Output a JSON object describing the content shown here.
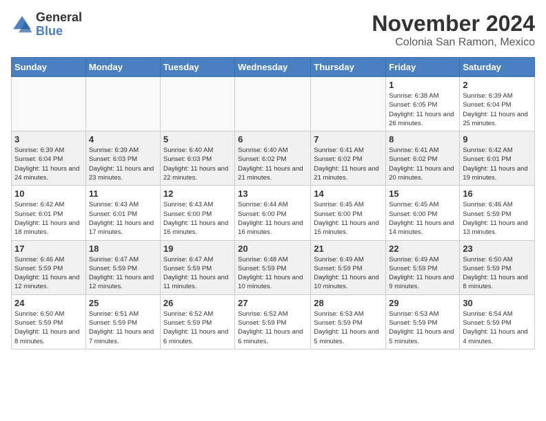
{
  "logo": {
    "general": "General",
    "blue": "Blue"
  },
  "title": "November 2024",
  "subtitle": "Colonia San Ramon, Mexico",
  "headers": [
    "Sunday",
    "Monday",
    "Tuesday",
    "Wednesday",
    "Thursday",
    "Friday",
    "Saturday"
  ],
  "weeks": [
    [
      {
        "day": "",
        "info": ""
      },
      {
        "day": "",
        "info": ""
      },
      {
        "day": "",
        "info": ""
      },
      {
        "day": "",
        "info": ""
      },
      {
        "day": "",
        "info": ""
      },
      {
        "day": "1",
        "info": "Sunrise: 6:38 AM\nSunset: 6:05 PM\nDaylight: 11 hours and 26 minutes."
      },
      {
        "day": "2",
        "info": "Sunrise: 6:39 AM\nSunset: 6:04 PM\nDaylight: 11 hours and 25 minutes."
      }
    ],
    [
      {
        "day": "3",
        "info": "Sunrise: 6:39 AM\nSunset: 6:04 PM\nDaylight: 11 hours and 24 minutes."
      },
      {
        "day": "4",
        "info": "Sunrise: 6:39 AM\nSunset: 6:03 PM\nDaylight: 11 hours and 23 minutes."
      },
      {
        "day": "5",
        "info": "Sunrise: 6:40 AM\nSunset: 6:03 PM\nDaylight: 11 hours and 22 minutes."
      },
      {
        "day": "6",
        "info": "Sunrise: 6:40 AM\nSunset: 6:02 PM\nDaylight: 11 hours and 21 minutes."
      },
      {
        "day": "7",
        "info": "Sunrise: 6:41 AM\nSunset: 6:02 PM\nDaylight: 11 hours and 21 minutes."
      },
      {
        "day": "8",
        "info": "Sunrise: 6:41 AM\nSunset: 6:02 PM\nDaylight: 11 hours and 20 minutes."
      },
      {
        "day": "9",
        "info": "Sunrise: 6:42 AM\nSunset: 6:01 PM\nDaylight: 11 hours and 19 minutes."
      }
    ],
    [
      {
        "day": "10",
        "info": "Sunrise: 6:42 AM\nSunset: 6:01 PM\nDaylight: 11 hours and 18 minutes."
      },
      {
        "day": "11",
        "info": "Sunrise: 6:43 AM\nSunset: 6:01 PM\nDaylight: 11 hours and 17 minutes."
      },
      {
        "day": "12",
        "info": "Sunrise: 6:43 AM\nSunset: 6:00 PM\nDaylight: 11 hours and 16 minutes."
      },
      {
        "day": "13",
        "info": "Sunrise: 6:44 AM\nSunset: 6:00 PM\nDaylight: 11 hours and 16 minutes."
      },
      {
        "day": "14",
        "info": "Sunrise: 6:45 AM\nSunset: 6:00 PM\nDaylight: 11 hours and 15 minutes."
      },
      {
        "day": "15",
        "info": "Sunrise: 6:45 AM\nSunset: 6:00 PM\nDaylight: 11 hours and 14 minutes."
      },
      {
        "day": "16",
        "info": "Sunrise: 6:46 AM\nSunset: 5:59 PM\nDaylight: 11 hours and 13 minutes."
      }
    ],
    [
      {
        "day": "17",
        "info": "Sunrise: 6:46 AM\nSunset: 5:59 PM\nDaylight: 11 hours and 12 minutes."
      },
      {
        "day": "18",
        "info": "Sunrise: 6:47 AM\nSunset: 5:59 PM\nDaylight: 11 hours and 12 minutes."
      },
      {
        "day": "19",
        "info": "Sunrise: 6:47 AM\nSunset: 5:59 PM\nDaylight: 11 hours and 11 minutes."
      },
      {
        "day": "20",
        "info": "Sunrise: 6:48 AM\nSunset: 5:59 PM\nDaylight: 11 hours and 10 minutes."
      },
      {
        "day": "21",
        "info": "Sunrise: 6:49 AM\nSunset: 5:59 PM\nDaylight: 11 hours and 10 minutes."
      },
      {
        "day": "22",
        "info": "Sunrise: 6:49 AM\nSunset: 5:59 PM\nDaylight: 11 hours and 9 minutes."
      },
      {
        "day": "23",
        "info": "Sunrise: 6:50 AM\nSunset: 5:59 PM\nDaylight: 11 hours and 8 minutes."
      }
    ],
    [
      {
        "day": "24",
        "info": "Sunrise: 6:50 AM\nSunset: 5:59 PM\nDaylight: 11 hours and 8 minutes."
      },
      {
        "day": "25",
        "info": "Sunrise: 6:51 AM\nSunset: 5:59 PM\nDaylight: 11 hours and 7 minutes."
      },
      {
        "day": "26",
        "info": "Sunrise: 6:52 AM\nSunset: 5:59 PM\nDaylight: 11 hours and 6 minutes."
      },
      {
        "day": "27",
        "info": "Sunrise: 6:52 AM\nSunset: 5:59 PM\nDaylight: 11 hours and 6 minutes."
      },
      {
        "day": "28",
        "info": "Sunrise: 6:53 AM\nSunset: 5:59 PM\nDaylight: 11 hours and 5 minutes."
      },
      {
        "day": "29",
        "info": "Sunrise: 6:53 AM\nSunset: 5:59 PM\nDaylight: 11 hours and 5 minutes."
      },
      {
        "day": "30",
        "info": "Sunrise: 6:54 AM\nSunset: 5:59 PM\nDaylight: 11 hours and 4 minutes."
      }
    ]
  ]
}
